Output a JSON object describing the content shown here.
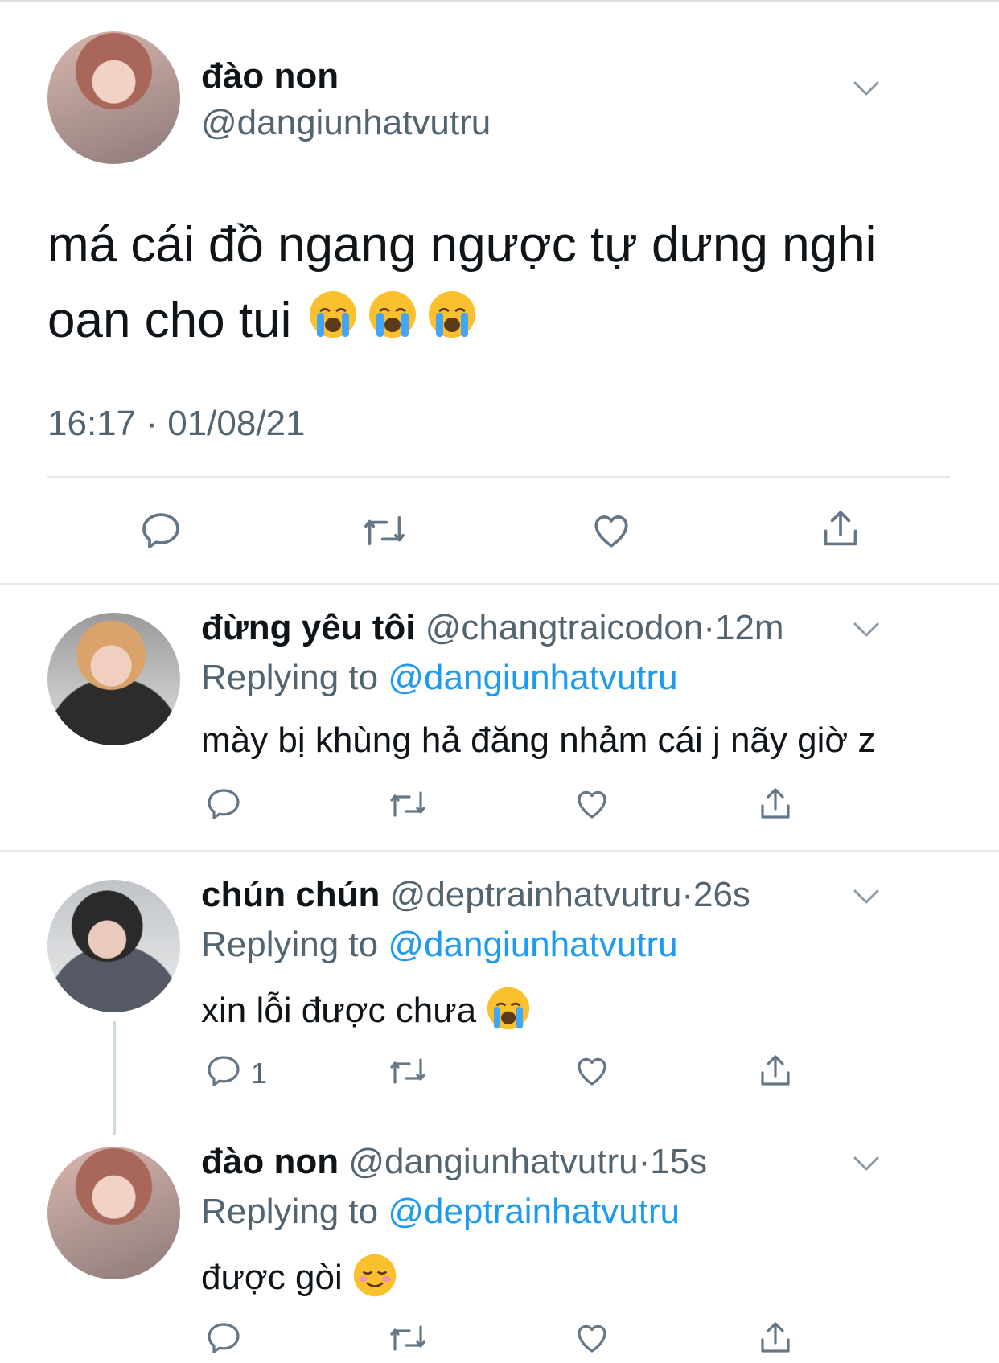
{
  "main_tweet": {
    "display_name": "đào non",
    "handle": "@dangiunhatvutru",
    "text": "má cái đồ ngang ngược tự dưng nghi oan cho tui",
    "text_emoji": "loudly-crying-face",
    "timestamp": "16:17 · 01/08/21"
  },
  "replies": [
    {
      "display_name": "đừng yêu tôi",
      "handle": "@changtraicodon",
      "time": "12m",
      "replying_label": "Replying to",
      "replying_to": "@dangiunhatvutru",
      "text": "mày bị khùng hả đăng nhảm cái j nãy giờ z"
    },
    {
      "display_name": "chún chún",
      "handle": "@deptrainhatvutru",
      "time": "26s",
      "replying_label": "Replying to",
      "replying_to": "@dangiunhatvutru",
      "text": "xin lỗi được chưa",
      "text_emoji": "loudly-crying-face",
      "reply_count": "1"
    },
    {
      "display_name": "đào non",
      "handle": "@dangiunhatvutru",
      "time": "15s",
      "replying_label": "Replying to",
      "replying_to": "@deptrainhatvutru",
      "text": "được gòi",
      "text_emoji": "smiling-face"
    }
  ],
  "meta_separator": "·",
  "colors": {
    "text": "#0f1419",
    "secondary": "#536471",
    "link": "#1d9bf0",
    "divider": "#e6e6e6"
  },
  "icons": [
    "comment-icon",
    "retweet-icon",
    "like-icon",
    "share-icon",
    "chevron-down-icon"
  ]
}
